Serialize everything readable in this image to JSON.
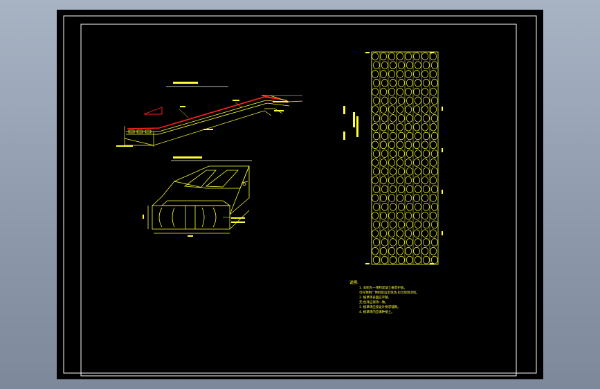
{
  "app": {
    "background_colors": [
      "#a8b3c4",
      "#7d889b"
    ],
    "canvas_color": "#000000"
  },
  "colors": {
    "frame": "#ffffff",
    "drawing": "#ffff33",
    "accent_red": "#ff2020",
    "title_underline": "#ffffff"
  },
  "notes": {
    "heading": "说明:",
    "lines": [
      "1. 本图为一预制混凝土植草护坡。",
      "   可在预制厂预制后运至现场,也可现场浇筑。",
      "2. 植草砖表面应平整,",
      "   无,色泽应保持一致。",
      "3. 植草砖应按设计要求铺砌。",
      "4. 植草砖内应填种植土。"
    ]
  }
}
